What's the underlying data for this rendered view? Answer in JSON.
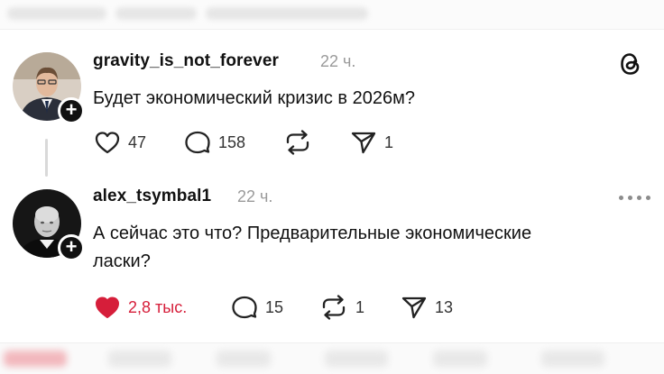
{
  "posts": [
    {
      "username": "gravity_is_not_forever",
      "time": "22 ч.",
      "text": "Будет экономический кризис в 2026м?",
      "likes": "47",
      "replies": "158",
      "reposts": "",
      "shares": "1",
      "liked": false
    },
    {
      "username": "alex_tsymbal1",
      "time": "22 ч.",
      "text_line1": "А сейчас это что? Предварительные экономические",
      "text_line2": "ласки?",
      "likes": "2,8 тыс.",
      "replies": "15",
      "reposts": "1",
      "shares": "13",
      "liked": true
    }
  ],
  "colors": {
    "like_red": "#d61e3a",
    "time_gray": "#9a9a9a",
    "icon": "#222222"
  },
  "icons": [
    "threads-logo-icon",
    "heart-icon",
    "comment-icon",
    "repost-icon",
    "share-icon",
    "more-icon",
    "follow-plus-icon"
  ]
}
